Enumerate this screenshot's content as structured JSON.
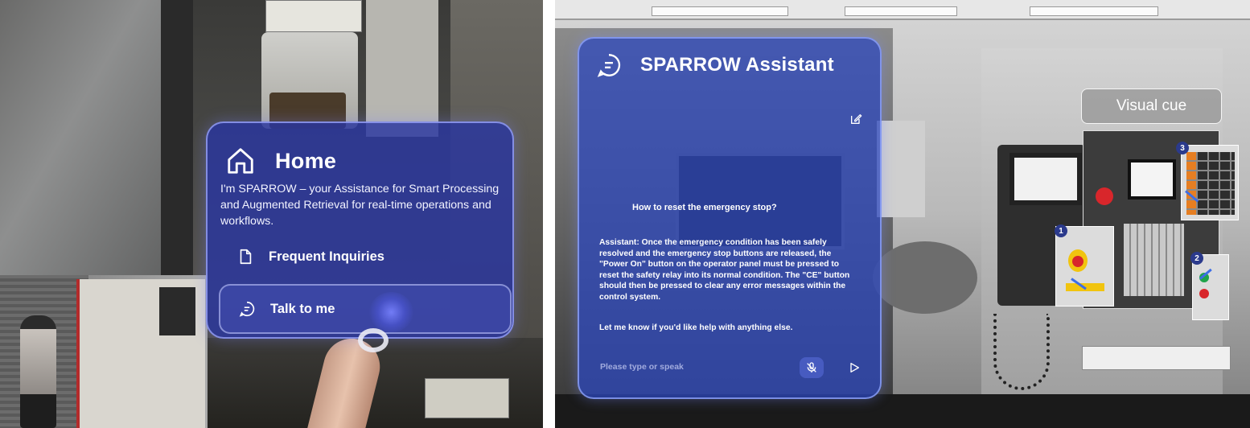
{
  "home": {
    "title": "Home",
    "description": "I'm SPARROW – your Assistance for Smart Processing and Augmented Retrieval for real-time operations and workflows.",
    "menu": [
      {
        "label": "Frequent Inquiries",
        "icon": "document-icon"
      },
      {
        "label": "Talk to me",
        "icon": "chat-icon"
      }
    ]
  },
  "assistant": {
    "title": "SPARROW Assistant",
    "user_message": "How to reset the emergency stop?",
    "answer": "Assistant: Once the emergency condition has been safely resolved and the emergency stop buttons are released, the \"Power On\" button on the operator panel must be pressed to reset the safety relay into its normal condition. The \"CE\" button should then be pressed to clear any error messages within the control system.",
    "follow_up": "Let me know if you'd like help with anything else.",
    "input_placeholder": "Please type or speak",
    "input_value": ""
  },
  "visual_cue": {
    "label": "Visual cue",
    "badges": [
      "1",
      "2",
      "3"
    ]
  },
  "colors": {
    "panel_blue": "#2c48be",
    "home_panel_blue": "#2a36a0",
    "accent_glow": "#7882ff"
  }
}
